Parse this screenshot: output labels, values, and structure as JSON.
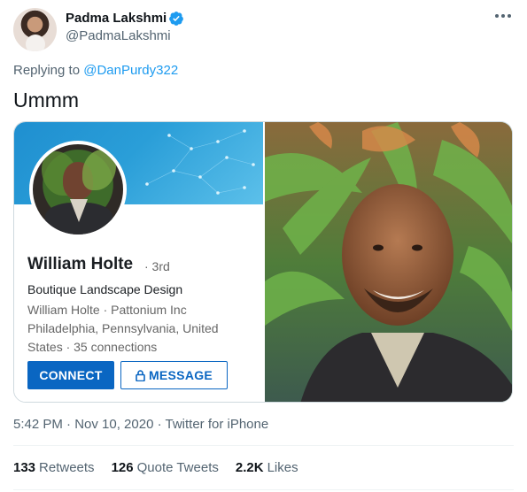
{
  "author": {
    "display_name": "Padma Lakshmi",
    "handle": "@PadmaLakshmi",
    "verified": true
  },
  "reply": {
    "prefix": "Replying to",
    "mention": "@DanPurdy322"
  },
  "tweet": {
    "text": "Ummm"
  },
  "linkedin_card": {
    "name": "William Holte",
    "degree": "· 3rd",
    "headline": "Boutique Landscape Design",
    "meta": "William Holte · Pattonium Inc Philadelphia, Pennsylvania, United States · 35 connections",
    "connect_label": "CONNECT",
    "message_label": "MESSAGE",
    "brand_color": "#0a66c2"
  },
  "footer": {
    "timestamp": "5:42 PM · Nov 10, 2020 · Twitter for iPhone",
    "retweets_count": "133",
    "retweets_label": "Retweets",
    "quotes_count": "126",
    "quotes_label": "Quote Tweets",
    "likes_count": "2.2K",
    "likes_label": "Likes"
  },
  "icons": {
    "verified": "verified-badge-icon",
    "more": "more-options-icon",
    "lock": "lock-icon"
  },
  "colors": {
    "twitter_blue": "#1d9bf0",
    "secondary_text": "#536471"
  }
}
